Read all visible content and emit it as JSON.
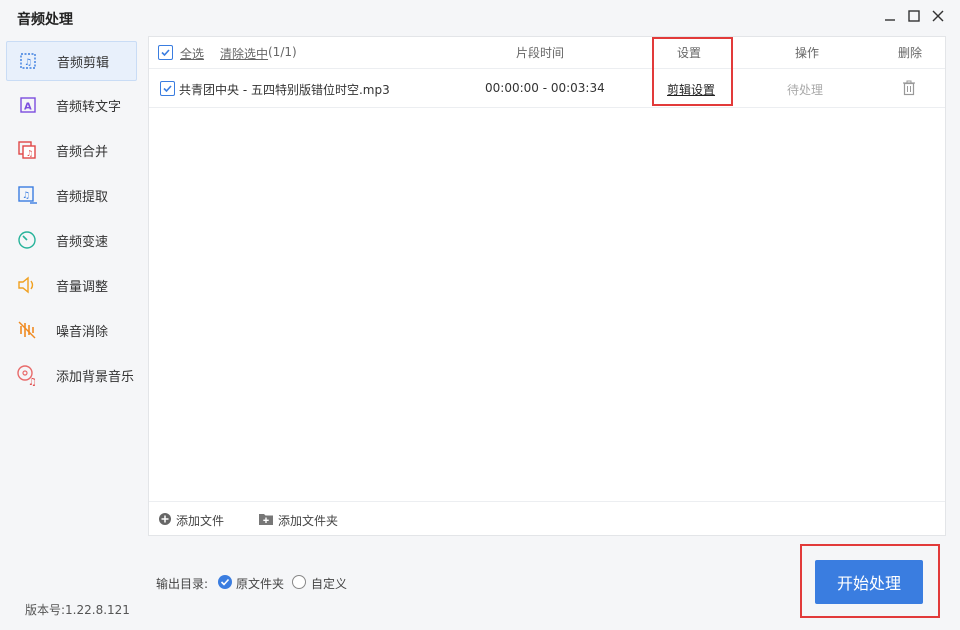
{
  "app": {
    "title": "音频处理",
    "version": "版本号:1.22.8.121"
  },
  "sidebar": {
    "items": [
      {
        "label": "音频剪辑",
        "icon": "audio-cut-icon",
        "active": true
      },
      {
        "label": "音频转文字",
        "icon": "audio-to-text-icon"
      },
      {
        "label": "音频合并",
        "icon": "audio-merge-icon"
      },
      {
        "label": "音频提取",
        "icon": "audio-extract-icon"
      },
      {
        "label": "音频变速",
        "icon": "audio-speed-icon"
      },
      {
        "label": "音量调整",
        "icon": "volume-icon"
      },
      {
        "label": "噪音消除",
        "icon": "noise-removal-icon"
      },
      {
        "label": "添加背景音乐",
        "icon": "background-music-icon"
      }
    ]
  },
  "table": {
    "select_all": "全选",
    "clear_selected": "清除选中",
    "selection_count": "(1/1)",
    "headers": {
      "segment": "片段时间",
      "settings": "设置",
      "operation": "操作",
      "delete": "删除"
    },
    "rows": [
      {
        "filename": "共青团中央 - 五四特别版错位时空.mp3",
        "segment": "00:00:00 - 00:03:34",
        "settings_link": "剪辑设置",
        "status": "待处理",
        "checked": true
      }
    ],
    "add_file": "添加文件",
    "add_folder": "添加文件夹"
  },
  "output": {
    "label": "输出目录:",
    "options": [
      "原文件夹",
      "自定义"
    ],
    "selected": "原文件夹"
  },
  "start_button": "开始处理",
  "colors": {
    "accent": "#3a7de0",
    "highlight": "#e23a3a"
  }
}
